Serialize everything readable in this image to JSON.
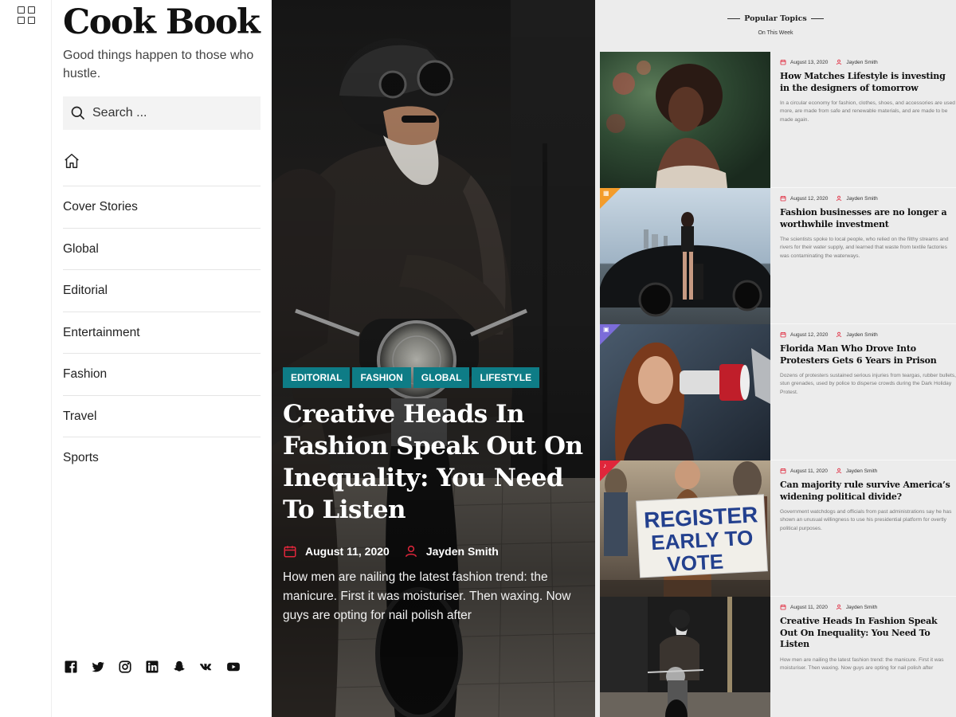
{
  "site": {
    "title": "Cook Book",
    "tagline": "Good things happen to those who hustle."
  },
  "search": {
    "placeholder": "Search ..."
  },
  "nav": [
    {
      "label": "Cover Stories"
    },
    {
      "label": "Global"
    },
    {
      "label": "Editorial"
    },
    {
      "label": "Entertainment"
    },
    {
      "label": "Fashion"
    },
    {
      "label": "Travel"
    },
    {
      "label": "Sports"
    }
  ],
  "social_icons": [
    "facebook-icon",
    "twitter-icon",
    "instagram-icon",
    "linkedin-icon",
    "snapchat-icon",
    "vk-icon",
    "youtube-icon"
  ],
  "hero": {
    "tags": [
      "EDITORIAL",
      "FASHION",
      "GLOBAL",
      "LIFESTYLE"
    ],
    "title": "Creative Heads In Fashion Speak Out On Inequality: You Need To Listen",
    "date": "August 11, 2020",
    "author": "Jayden Smith",
    "excerpt": "How men are nailing the latest fashion trend: the manicure. First it was moisturiser. Then waxing. Now guys are opting for nail polish after"
  },
  "popular": {
    "title": "Popular Topics",
    "subtitle": "On This Week",
    "posts": [
      {
        "date": "August 13, 2020",
        "author": "Jayden Smith",
        "title": "How Matches Lifestyle is investing in the designers of tomorrow",
        "excerpt": "In a circular economy for fashion, clothes, shoes, and accessories are used more, are made from safe and renewable materials, and are made to be made again."
      },
      {
        "date": "August 12, 2020",
        "author": "Jayden Smith",
        "title": "Fashion businesses are no longer a worthwhile investment",
        "excerpt": "The scientists spoke to local people, who relied on the filthy streams and rivers for their water supply, and learned that waste from textile factories was contaminating the waterways."
      },
      {
        "date": "August 12, 2020",
        "author": "Jayden Smith",
        "title": "Florida Man Who Drove Into Protesters Gets 6 Years in Prison",
        "excerpt": "Dozens of protesters sustained serious injuries from teargas, rubber bullets, stun grenades, used by police to disperse crowds during the Dark Holiday Protest."
      },
      {
        "date": "August 11, 2020",
        "author": "Jayden Smith",
        "title": "Can majority rule survive America’s widening political divide?",
        "excerpt": "Government watchdogs and officials from past administrations say he has shown an unusual willingness to use his presidential platform for overtly political purposes.",
        "sign_text": [
          "REGISTER",
          "EARLY TO",
          "VOTE"
        ]
      },
      {
        "date": "August 11, 2020",
        "author": "Jayden Smith",
        "title": "Creative Heads In Fashion Speak Out On Inequality: You Need To Listen",
        "excerpt": "How men are nailing the latest fashion trend: the manicure. First it was moisturiser. Then waxing. Now guys are opting for nail polish after"
      }
    ]
  },
  "colors": {
    "tag_bg": "#0e7c86",
    "meta_icon": "#e0263b",
    "corner_orange": "#f39c2b",
    "corner_purple": "#7b6cd9",
    "corner_red": "#e0263b"
  }
}
